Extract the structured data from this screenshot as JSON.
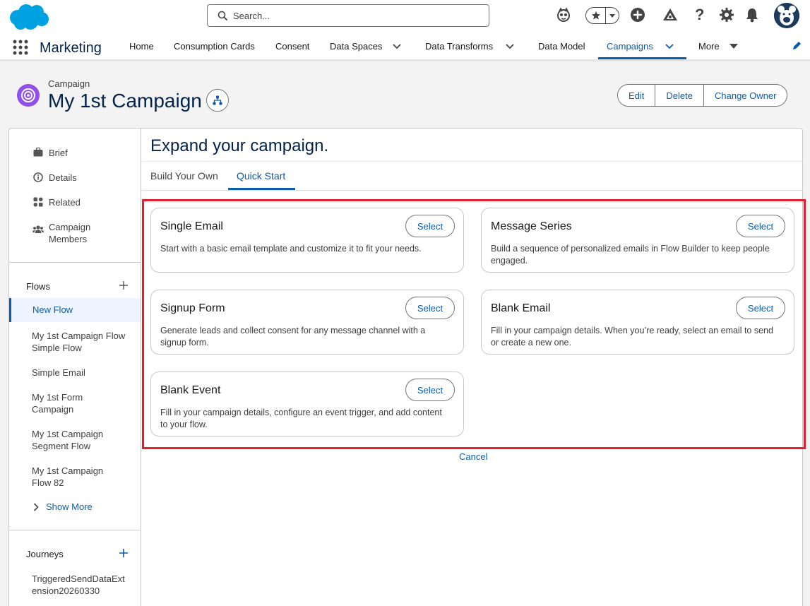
{
  "header": {
    "search_placeholder": "Search...",
    "icons": [
      "einstein-icon",
      "star-icon",
      "chevron-down-icon",
      "add-icon",
      "setup-assistant-icon",
      "help-icon",
      "gear-icon",
      "bell-icon",
      "avatar-icon"
    ]
  },
  "app_nav": {
    "app_name": "Marketing",
    "items": [
      {
        "label": "Home"
      },
      {
        "label": "Consumption Cards"
      },
      {
        "label": "Consent"
      },
      {
        "label": "Data Spaces"
      },
      {
        "label": "Data Transforms"
      },
      {
        "label": "Data Model"
      },
      {
        "label": "Campaigns"
      },
      {
        "label": "More"
      }
    ],
    "active": "Campaigns"
  },
  "record": {
    "type": "Campaign",
    "title": "My 1st Campaign",
    "actions": {
      "edit": "Edit",
      "delete": "Delete",
      "change_owner": "Change Owner"
    }
  },
  "sidebar": {
    "links": [
      {
        "label": "Brief"
      },
      {
        "label": "Details"
      },
      {
        "label": "Related"
      },
      {
        "label": "Campaign Members"
      }
    ],
    "flows_heading": "Flows",
    "flows": [
      {
        "label": "New Flow"
      },
      {
        "label": "My 1st Campaign Flow Simple Flow"
      },
      {
        "label": "Simple Email"
      },
      {
        "label": "My 1st Form Campaign"
      },
      {
        "label": "My 1st Campaign Segment Flow"
      },
      {
        "label": "My 1st Campaign Flow 82"
      }
    ],
    "show_more": "Show More",
    "journeys_heading": "Journeys",
    "journeys": [
      {
        "label": "TriggeredSendDataExt ension20260330"
      }
    ]
  },
  "content": {
    "title": "Expand your campaign.",
    "tabs": [
      {
        "label": "Build Your Own"
      },
      {
        "label": "Quick Start"
      }
    ],
    "active_tab": "Quick Start",
    "select_label": "Select",
    "tiles": [
      {
        "title": "Single Email",
        "description": "Start with a basic email template and customize it to fit your needs."
      },
      {
        "title": "Message Series",
        "description": "Build a sequence of personalized emails in Flow Builder to keep people engaged."
      },
      {
        "title": "Signup Form",
        "description": "Generate leads and collect consent for any message channel with a signup form."
      },
      {
        "title": "Blank Email",
        "description": "Fill in your campaign details. When you’re ready, select an email to send or create a new one."
      },
      {
        "title": "Blank Event",
        "description": "Fill in your campaign details, configure an event trigger, and add content to your flow."
      }
    ],
    "cancel": "Cancel"
  },
  "colors": {
    "brand": "#0b5cab",
    "highlight_border": "#e0202f",
    "campaign_icon": "#9050e9",
    "salesforce_cloud": "#00a1e0"
  }
}
